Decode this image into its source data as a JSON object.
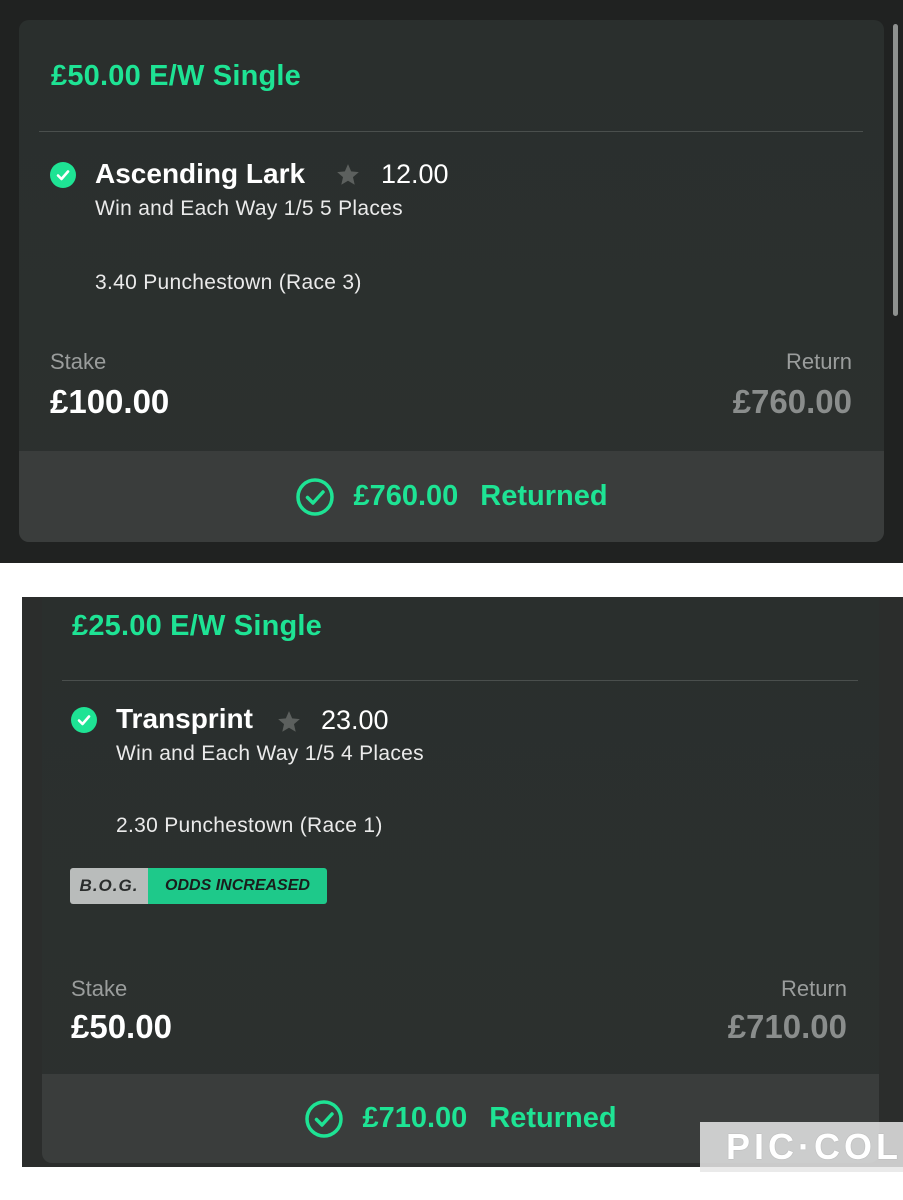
{
  "bets": [
    {
      "title": "£50.00 E/W Single",
      "selection": "Ascending Lark",
      "odds": "12.00",
      "market": "Win and Each Way 1/5 5 Places",
      "event": "3.40 Punchestown (Race 3)",
      "stake_label": "Stake",
      "stake": "£100.00",
      "return_label": "Return",
      "return": "£760.00",
      "returned_amount": "£760.00",
      "returned_text": "Returned"
    },
    {
      "title": "£25.00 E/W Single",
      "selection": "Transprint",
      "odds": "23.00",
      "market": "Win and Each Way 1/5 4 Places",
      "event": "2.30 Punchestown (Race 1)",
      "badge_left": "B.O.G.",
      "badge_right": "ODDS INCREASED",
      "stake_label": "Stake",
      "stake": "£50.00",
      "return_label": "Return",
      "return": "£710.00",
      "returned_amount": "£710.00",
      "returned_text": "Returned"
    }
  ],
  "watermark": "PIC·COL",
  "colors": {
    "accent": "#1ee394",
    "card": "#2b2e2d",
    "footer": "#3a3d3c"
  }
}
